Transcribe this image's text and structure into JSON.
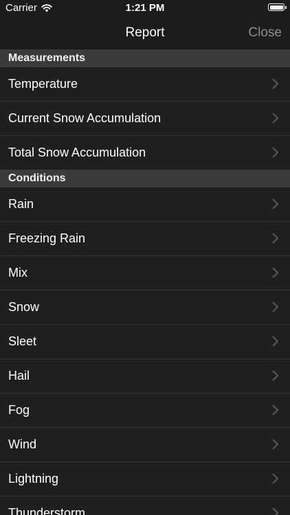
{
  "status": {
    "carrier": "Carrier",
    "time": "1:21 PM"
  },
  "nav": {
    "title": "Report",
    "close_label": "Close"
  },
  "sections": [
    {
      "header": "Measurements",
      "items": [
        "Temperature",
        "Current Snow Accumulation",
        "Total Snow Accumulation"
      ]
    },
    {
      "header": "Conditions",
      "items": [
        "Rain",
        "Freezing Rain",
        "Mix",
        "Snow",
        "Sleet",
        "Hail",
        "Fog",
        "Wind",
        "Lightning",
        "Thunderstorm"
      ]
    }
  ],
  "colors": {
    "background": "#1f1f21",
    "section_header": "#3b3b3e",
    "chevron": "#5a5a5e",
    "close": "#8e8e93"
  }
}
